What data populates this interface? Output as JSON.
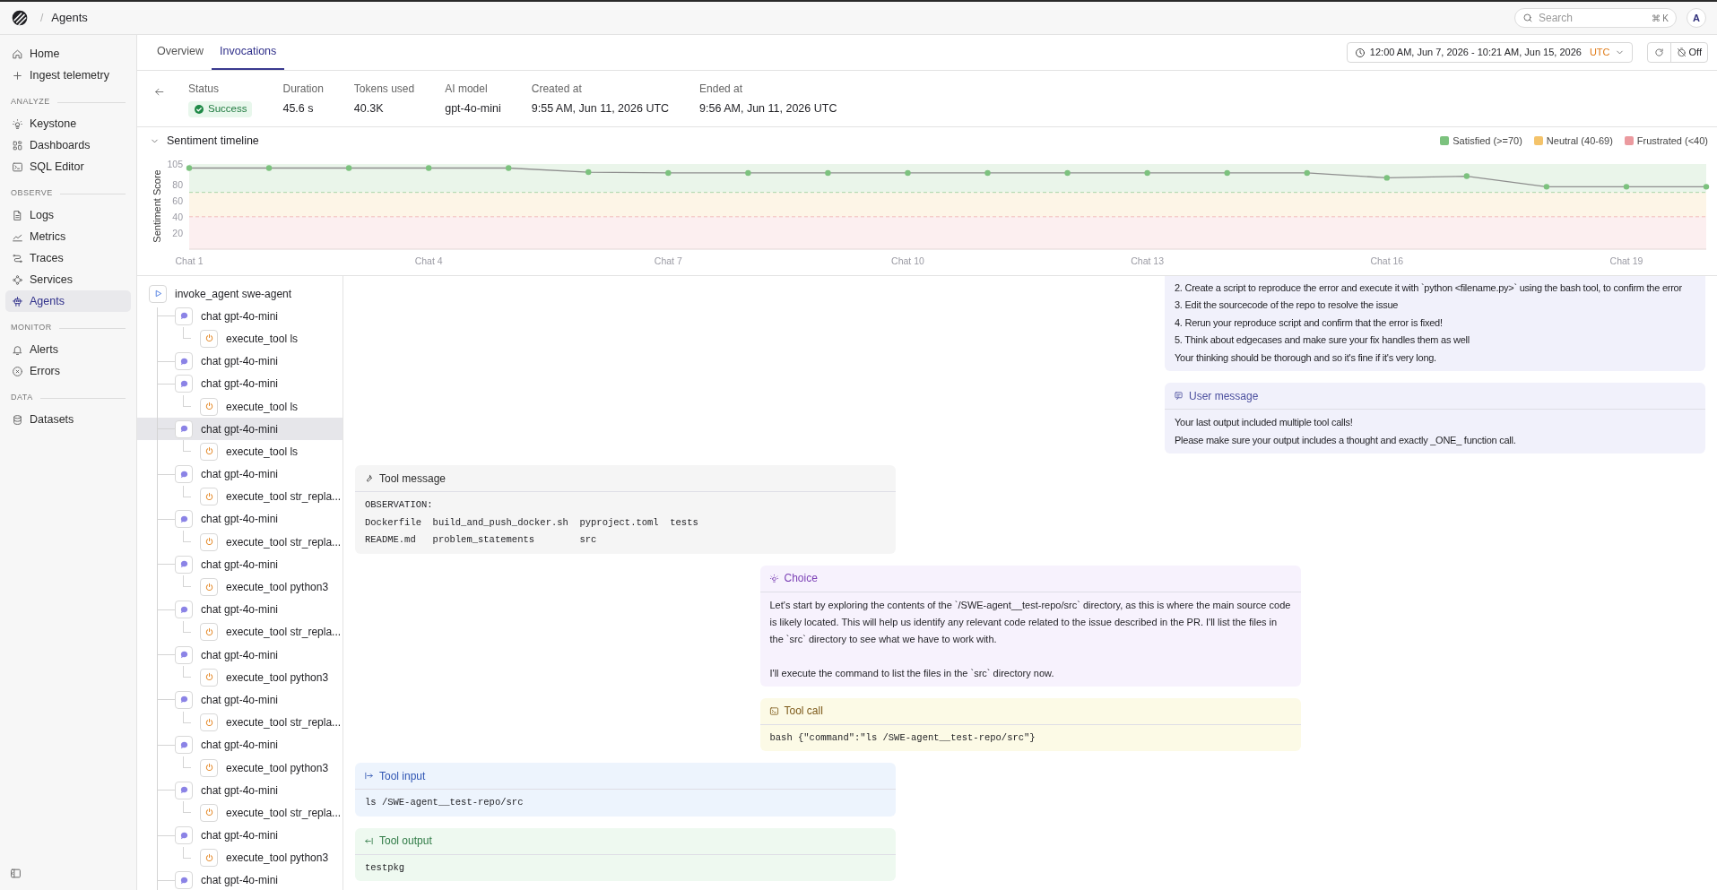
{
  "topbar": {
    "breadcrumb_separator": "/",
    "title": "Agents",
    "search": {
      "placeholder": "Search",
      "shortcut": "⌘ K"
    },
    "avatar": "A"
  },
  "sidebar": {
    "sections": [
      {
        "items": [
          {
            "label": "Home",
            "selected": false
          },
          {
            "label": "Ingest telemetry",
            "selected": false
          }
        ]
      },
      {
        "title": "ANALYZE",
        "items": [
          {
            "label": "Keystone",
            "selected": false
          },
          {
            "label": "Dashboards",
            "selected": false
          },
          {
            "label": "SQL Editor",
            "selected": false
          }
        ]
      },
      {
        "title": "OBSERVE",
        "items": [
          {
            "label": "Logs",
            "selected": false
          },
          {
            "label": "Metrics",
            "selected": false
          },
          {
            "label": "Traces",
            "selected": false
          },
          {
            "label": "Services",
            "selected": false
          },
          {
            "label": "Agents",
            "selected": true
          }
        ]
      },
      {
        "title": "MONITOR",
        "items": [
          {
            "label": "Alerts",
            "selected": false
          },
          {
            "label": "Errors",
            "selected": false
          }
        ]
      },
      {
        "title": "DATA",
        "items": [
          {
            "label": "Datasets",
            "selected": false
          }
        ]
      }
    ]
  },
  "tabs": [
    {
      "label": "Overview",
      "selected": false
    },
    {
      "label": "Invocations",
      "selected": true
    }
  ],
  "time_range": {
    "label": "12:00 AM, Jun 7, 2026 - 10:21 AM, Jun 15, 2026",
    "timezone": "UTC"
  },
  "auto_refresh": "Off",
  "stats": [
    {
      "label": "Status",
      "value": "Success",
      "kind": "badge"
    },
    {
      "label": "Duration",
      "value": "45.6 s",
      "kind": "text"
    },
    {
      "label": "Tokens used",
      "value": "40.3K",
      "kind": "text"
    },
    {
      "label": "AI model",
      "value": "gpt-4o-mini",
      "kind": "text"
    },
    {
      "label": "Created at",
      "value": "9:55 AM, Jun 11, 2026 UTC",
      "kind": "text"
    },
    {
      "label": "Ended at",
      "value": "9:56 AM, Jun 11, 2026 UTC",
      "kind": "text"
    }
  ],
  "sentiment": {
    "title": "Sentiment timeline",
    "expanded": true,
    "legend": [
      {
        "label": "Satisfied (>=70)",
        "color": "#7cc27e"
      },
      {
        "label": "Neutral (40-69)",
        "color": "#f4c36a"
      },
      {
        "label": "Frustrated (<40)",
        "color": "#eb9a9f"
      }
    ],
    "chart_data": {
      "type": "line",
      "ylabel": "Sentiment Score",
      "categories": [
        "Chat 1",
        null,
        null,
        "Chat 4",
        null,
        null,
        "Chat 7",
        null,
        null,
        "Chat 10",
        null,
        null,
        "Chat 13",
        null,
        null,
        "Chat 16",
        null,
        null,
        "Chat 19",
        null
      ],
      "series": [
        {
          "color": "#8e8e8e",
          "marker": true,
          "values": [
            100,
            100,
            100,
            100,
            100,
            95,
            94,
            94,
            94,
            94,
            94,
            94,
            94,
            94,
            94,
            88,
            90,
            77,
            77,
            77
          ]
        }
      ],
      "ylim": [
        0,
        105
      ],
      "yticks": [
        20,
        40,
        60,
        80,
        105
      ],
      "bands": [
        {
          "axis": "y",
          "from": 70,
          "to": 105,
          "color": "#7cc27e"
        },
        {
          "axis": "y",
          "from": 40,
          "to": 70,
          "color": "#f4c36a"
        },
        {
          "axis": "y",
          "from": 0,
          "to": 40,
          "color": "#eb9a9f"
        }
      ],
      "ref_lines": [
        {
          "axis": "y",
          "value": 70,
          "color": "#7cc27e"
        },
        {
          "axis": "y",
          "value": 40,
          "color": "#eb9a9f"
        }
      ]
    }
  },
  "tree": {
    "label": "invoke_agent swe-agent",
    "kind": "agent",
    "selected": false,
    "children": [
      {
        "label": "chat gpt-4o-mini",
        "kind": "chat",
        "selected": false,
        "children": [
          {
            "label": "execute_tool ls",
            "kind": "tool",
            "selected": false
          }
        ]
      },
      {
        "label": "chat gpt-4o-mini",
        "kind": "chat",
        "selected": false
      },
      {
        "label": "chat gpt-4o-mini",
        "kind": "chat",
        "selected": false,
        "children": [
          {
            "label": "execute_tool ls",
            "kind": "tool",
            "selected": false
          }
        ]
      },
      {
        "label": "chat gpt-4o-mini",
        "kind": "chat",
        "selected": true,
        "children": [
          {
            "label": "execute_tool ls",
            "kind": "tool",
            "selected": false
          }
        ]
      },
      {
        "label": "chat gpt-4o-mini",
        "kind": "chat",
        "selected": false,
        "children": [
          {
            "label": "execute_tool str_repla...",
            "kind": "tool",
            "selected": false
          }
        ]
      },
      {
        "label": "chat gpt-4o-mini",
        "kind": "chat",
        "selected": false,
        "children": [
          {
            "label": "execute_tool str_repla...",
            "kind": "tool",
            "selected": false
          }
        ]
      },
      {
        "label": "chat gpt-4o-mini",
        "kind": "chat",
        "selected": false,
        "children": [
          {
            "label": "execute_tool python3",
            "kind": "tool",
            "selected": false
          }
        ]
      },
      {
        "label": "chat gpt-4o-mini",
        "kind": "chat",
        "selected": false,
        "children": [
          {
            "label": "execute_tool str_repla...",
            "kind": "tool",
            "selected": false
          }
        ]
      },
      {
        "label": "chat gpt-4o-mini",
        "kind": "chat",
        "selected": false,
        "children": [
          {
            "label": "execute_tool python3",
            "kind": "tool",
            "selected": false
          }
        ]
      },
      {
        "label": "chat gpt-4o-mini",
        "kind": "chat",
        "selected": false,
        "children": [
          {
            "label": "execute_tool str_repla...",
            "kind": "tool",
            "selected": false
          }
        ]
      },
      {
        "label": "chat gpt-4o-mini",
        "kind": "chat",
        "selected": false,
        "children": [
          {
            "label": "execute_tool python3",
            "kind": "tool",
            "selected": false
          }
        ]
      },
      {
        "label": "chat gpt-4o-mini",
        "kind": "chat",
        "selected": false,
        "children": [
          {
            "label": "execute_tool str_repla...",
            "kind": "tool",
            "selected": false
          }
        ]
      },
      {
        "label": "chat gpt-4o-mini",
        "kind": "chat",
        "selected": false,
        "children": [
          {
            "label": "execute_tool python3",
            "kind": "tool",
            "selected": false
          }
        ]
      },
      {
        "label": "chat gpt-4o-mini",
        "kind": "chat",
        "selected": false
      }
    ]
  },
  "messages": [
    {
      "kind": "system",
      "lines": [
        "2. Create a script to reproduce the error and execute it with `python <filename.py>` using the bash tool, to confirm the error",
        "3. Edit the sourcecode of the repo to resolve the issue",
        "4. Rerun your reproduce script and confirm that the error is fixed!",
        "5. Think about edgecases and make sure your fix handles them as well",
        "Your thinking should be thorough and so it's fine if it's very long."
      ]
    },
    {
      "kind": "user",
      "title": "User message",
      "lines": [
        "Your last output included multiple tool calls!",
        "Please make sure your output includes a thought and exactly _ONE_ function call."
      ]
    },
    {
      "kind": "tool",
      "title": "Tool message",
      "code": [
        "OBSERVATION:",
        "Dockerfile  build_and_push_docker.sh  pyproject.toml  tests",
        "README.md   problem_statements        src"
      ]
    },
    {
      "kind": "choice",
      "title": "Choice",
      "paragraphs": [
        "Let's start by exploring the contents of the `/SWE-agent__test-repo/src` directory, as this is where the main source code is likely located. This will help us identify any relevant code related to the issue described in the PR. I'll list the files in the `src` directory to see what we have to work with.",
        "I'll execute the command to list the files in the `src` directory now."
      ]
    },
    {
      "kind": "tool_call",
      "title": "Tool call",
      "code": [
        "bash {\"command\":\"ls /SWE-agent__test-repo/src\"}"
      ]
    },
    {
      "kind": "tool_input",
      "title": "Tool input",
      "code": [
        "ls /SWE-agent__test-repo/src"
      ]
    },
    {
      "kind": "tool_output",
      "title": "Tool output",
      "code": [
        "testpkg"
      ]
    }
  ]
}
